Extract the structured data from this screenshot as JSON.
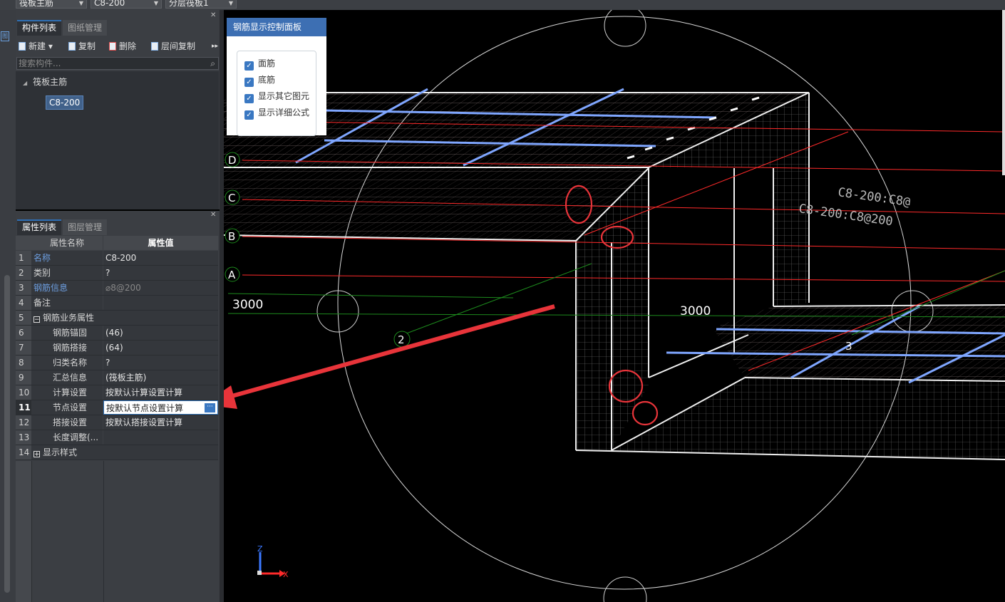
{
  "topbar": {
    "combo1": "筏板主筋",
    "combo2": "C8-200",
    "combo3": "分层筏板1"
  },
  "component_panel": {
    "tabs": [
      "构件列表",
      "图纸管理"
    ],
    "toolbar": {
      "new_label": "新建",
      "copy_label": "复制",
      "delete_label": "删除",
      "floor_copy_label": "层间复制"
    },
    "search_placeholder": "搜索构件...",
    "tree": {
      "root_label": "筏板主筋",
      "child_label": "C8-200"
    }
  },
  "property_panel": {
    "tabs": [
      "属性列表",
      "图层管理"
    ],
    "header": {
      "name_col": "属性名称",
      "value_col": "属性值"
    },
    "rows": [
      {
        "num": "1",
        "name": "名称",
        "value": "C8-200"
      },
      {
        "num": "2",
        "name": "类别",
        "value": "?"
      },
      {
        "num": "3",
        "name": "钢筋信息",
        "value": "⌀8@200"
      },
      {
        "num": "4",
        "name": "备注",
        "value": ""
      },
      {
        "num": "5",
        "name": "钢筋业务属性",
        "value": ""
      },
      {
        "num": "6",
        "name": "钢筋锚固",
        "value": "(46)"
      },
      {
        "num": "7",
        "name": "钢筋搭接",
        "value": "(64)"
      },
      {
        "num": "8",
        "name": "归类名称",
        "value": "?"
      },
      {
        "num": "9",
        "name": "汇总信息",
        "value": "(筏板主筋)"
      },
      {
        "num": "10",
        "name": "计算设置",
        "value": "按默认计算设置计算"
      },
      {
        "num": "11",
        "name": "节点设置",
        "value": "按默认节点设置计算"
      },
      {
        "num": "12",
        "name": "搭接设置",
        "value": "按默认搭接设置计算"
      },
      {
        "num": "13",
        "name": "长度调整(...",
        "value": ""
      },
      {
        "num": "14",
        "name": "显示样式",
        "value": ""
      }
    ]
  },
  "control_panel": {
    "title": "钢筋显示控制面板",
    "checkboxes": [
      {
        "label": "面筋",
        "checked": true
      },
      {
        "label": "底筋",
        "checked": true
      },
      {
        "label": "显示其它图元",
        "checked": true
      },
      {
        "label": "显示详细公式",
        "checked": true
      }
    ]
  },
  "viewport": {
    "axis_labels": [
      "D",
      "C",
      "B",
      "A"
    ],
    "dimension_left": "3000",
    "dimension_inner": "3000",
    "grid_number_2": "2",
    "grid_number_3": "3",
    "rebar_text_1": "C8-200:C8@",
    "rebar_text_2": "C8-200:C8@200",
    "axis_z": "Z",
    "axis_x": "X",
    "colors": {
      "wireframe": "#cfcfcf",
      "blue_rebar": "#7fa6ff",
      "red_line": "#ff2a2a",
      "green_line": "#1d8a1d",
      "annotation": "#e8343a"
    }
  }
}
